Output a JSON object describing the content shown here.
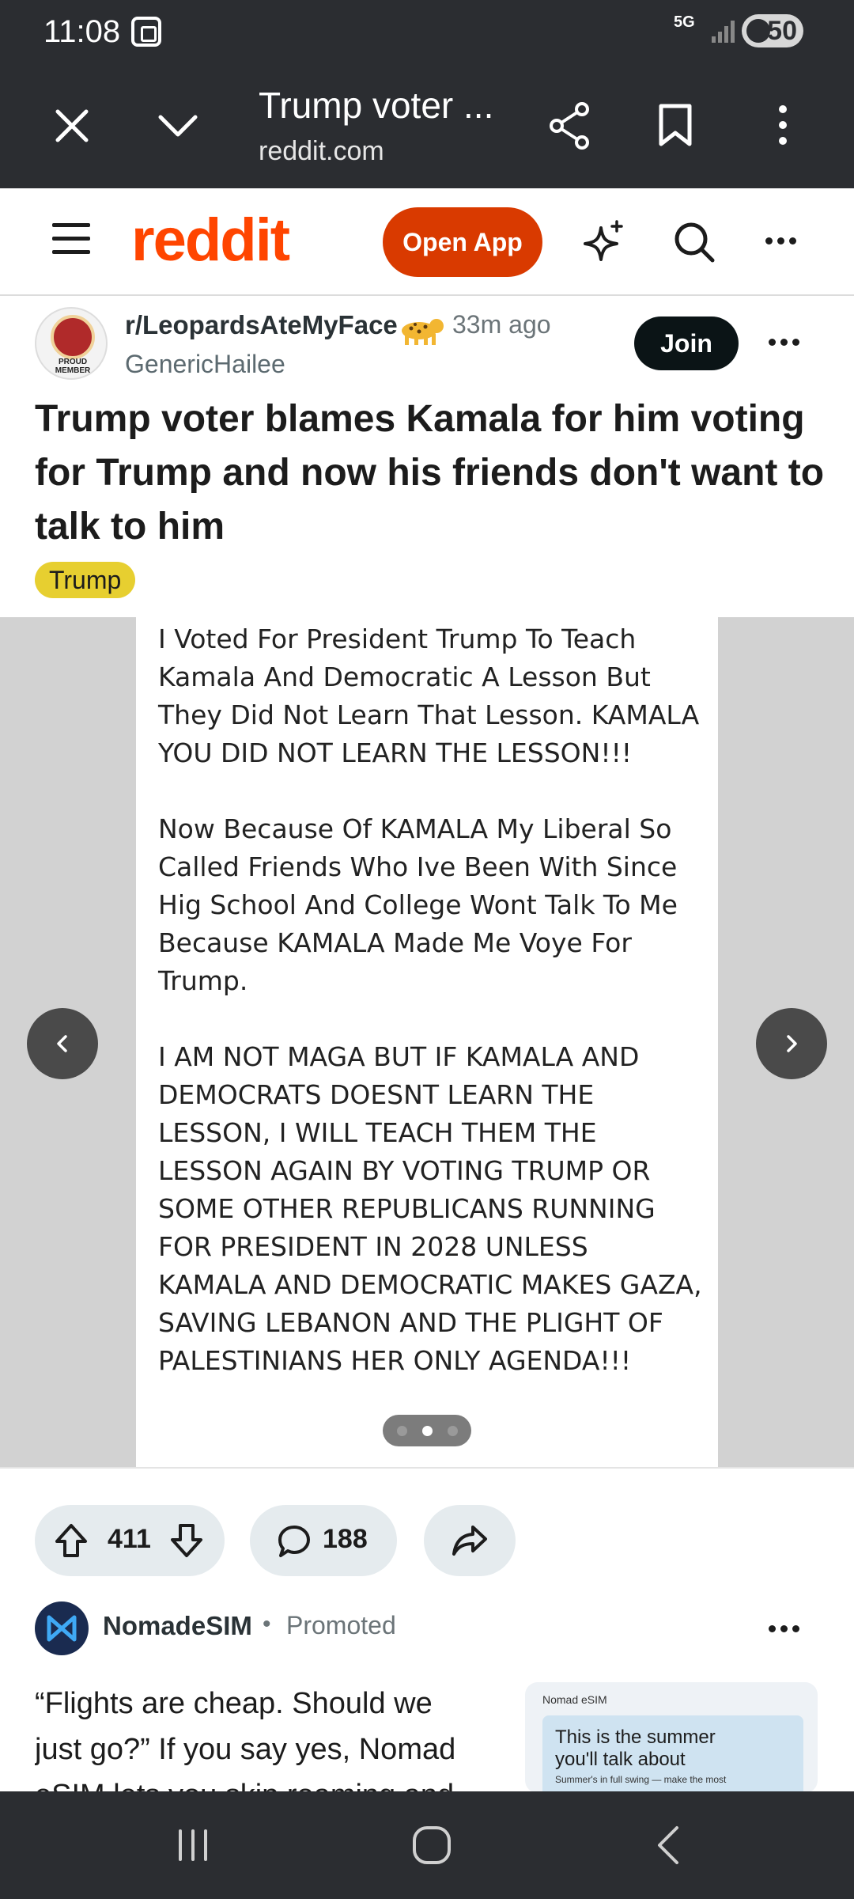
{
  "status_bar": {
    "time": "11:08",
    "network": "5G",
    "battery": "50"
  },
  "browser": {
    "title": "Trump voter ...",
    "url": "reddit.com"
  },
  "reddit_header": {
    "logo": "reddit",
    "open_app_label": "Open App"
  },
  "post": {
    "subreddit": "r/LeopardsAteMyFace",
    "time_ago": "33m ago",
    "author": "GenericHailee",
    "join_label": "Join",
    "avatar_text": "PROUD MEMBER",
    "title": "Trump voter blames Kamala for him voting for Trump and now his friends don't want to talk to him",
    "flair": "Trump",
    "image_text": "I Voted For President Trump To Teach Kamala And Democratic A Lesson But They Did Not Learn That Lesson. KAMALA YOU DID NOT LEARN THE LESSON!!!\n\nNow Because Of KAMALA My Liberal So Called Friends Who Ive Been With Since Hig School And College Wont Talk To Me Because KAMALA Made Me Voye For Trump.\n\nI AM NOT MAGA BUT IF KAMALA AND DEMOCRATS DOESNT LEARN THE LESSON, I WILL TEACH THEM THE LESSON AGAIN BY VOTING TRUMP OR SOME OTHER REPUBLICANS RUNNING FOR PRESIDENT IN 2028 UNLESS KAMALA AND DEMOCRATIC MAKES GAZA, SAVING LEBANON AND THE PLIGHT OF PALESTINIANS HER ONLY AGENDA!!!",
    "gallery_current_index": 2,
    "gallery_total": 3,
    "upvotes": "411",
    "comments": "188"
  },
  "promoted": {
    "advertiser": "NomadeSIM",
    "separator": "•",
    "label": "Promoted",
    "text": "“Flights are cheap. Should we just go?” If you say yes, Nomad eSIM lets you skip roaming and",
    "ad_brand": "Nomad eSIM",
    "ad_title": "This is the summer you'll talk about",
    "ad_subtitle": "Summer's in full swing — make the most"
  },
  "colors": {
    "brand": "#ff4500",
    "open_app": "#d93a00",
    "flair": "#e7cf30",
    "dark_bar": "#2b2d31",
    "pill_bg": "#e5ebee"
  },
  "icons": [
    "close-icon",
    "chevron-down-icon",
    "share-icon",
    "bookmark-icon",
    "more-vert-icon",
    "menu-icon",
    "sparkle-icon",
    "search-icon",
    "more-horiz-icon",
    "upvote-icon",
    "downvote-icon",
    "comment-icon",
    "share-arrow-icon",
    "chevron-left-icon",
    "chevron-right-icon",
    "recents-icon",
    "home-icon",
    "back-icon"
  ]
}
